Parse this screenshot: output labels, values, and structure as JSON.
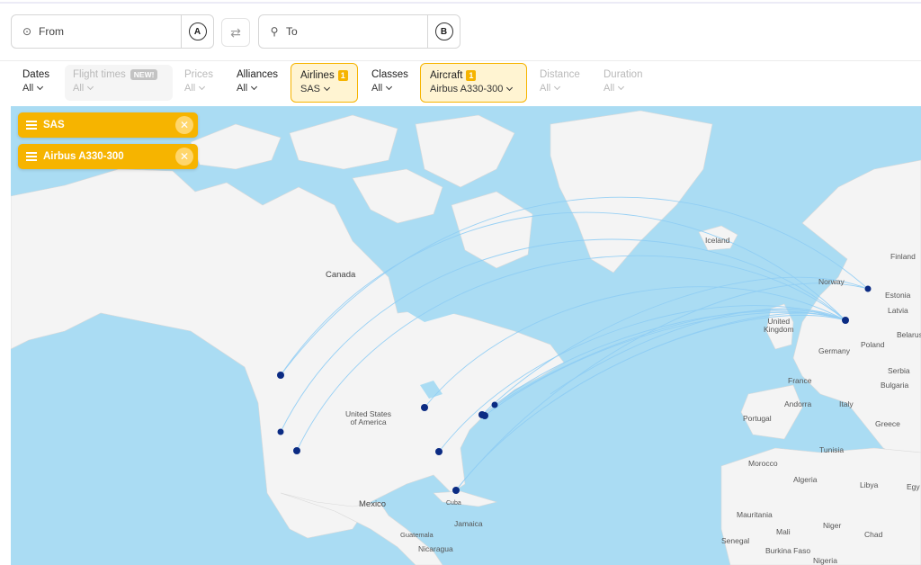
{
  "search": {
    "from_placeholder": "From",
    "from_badge": "A",
    "to_placeholder": "To",
    "to_badge": "B",
    "swap_icon": "swap-arrows-icon"
  },
  "filters": [
    {
      "label": "Dates",
      "value": "All",
      "state": "normal"
    },
    {
      "label": "Flight times",
      "value": "All",
      "badge": "NEW!",
      "state": "disabled"
    },
    {
      "label": "Prices",
      "value": "All",
      "state": "disabled"
    },
    {
      "label": "Alliances",
      "value": "All",
      "state": "normal"
    },
    {
      "label": "Airlines",
      "value": "SAS",
      "count": "1",
      "state": "active"
    },
    {
      "label": "Classes",
      "value": "All",
      "state": "normal"
    },
    {
      "label": "Aircraft",
      "value": "Airbus A330-300",
      "count": "1",
      "state": "active"
    },
    {
      "label": "Distance",
      "value": "All",
      "state": "disabled"
    },
    {
      "label": "Duration",
      "value": "All",
      "state": "disabled"
    }
  ],
  "active_chips": [
    {
      "label": "SAS"
    },
    {
      "label": "Airbus A330-300"
    }
  ],
  "map": {
    "labels": {
      "canada": "Canada",
      "usa": "United States\nof America",
      "mexico": "Mexico",
      "cuba": "Cuba",
      "jamaica": "Jamaica",
      "guatemala": "Guatemala",
      "nicaragua": "Nicaragua",
      "iceland": "Iceland",
      "finland": "Finland",
      "norway": "Norway",
      "estonia": "Estonia",
      "latvia": "Latvia",
      "uk": "United\nKingdom",
      "poland": "Poland",
      "belarus": "Belarus",
      "germany": "Germany",
      "france": "France",
      "serbia": "Serbia",
      "bulgaria": "Bulgaria",
      "andorra": "Andorra",
      "italy": "Italy",
      "portugal": "Portugal",
      "greece": "Greece",
      "tunisia": "Tunisia",
      "morocco": "Morocco",
      "algeria": "Algeria",
      "libya": "Libya",
      "egypt": "Egy",
      "mauritania": "Mauritania",
      "mali": "Mali",
      "niger": "Niger",
      "chad": "Chad",
      "senegal": "Senegal",
      "burkina": "Burkina Faso",
      "nigeria": "Nigeria"
    },
    "route_color": "#8fcdf4",
    "airport_color": "#0b2b83",
    "water_color": "#aadcf3",
    "land_color": "#f4f4f4"
  },
  "colors": {
    "accent": "#f6b400",
    "accent_light": "#fff4d2"
  }
}
